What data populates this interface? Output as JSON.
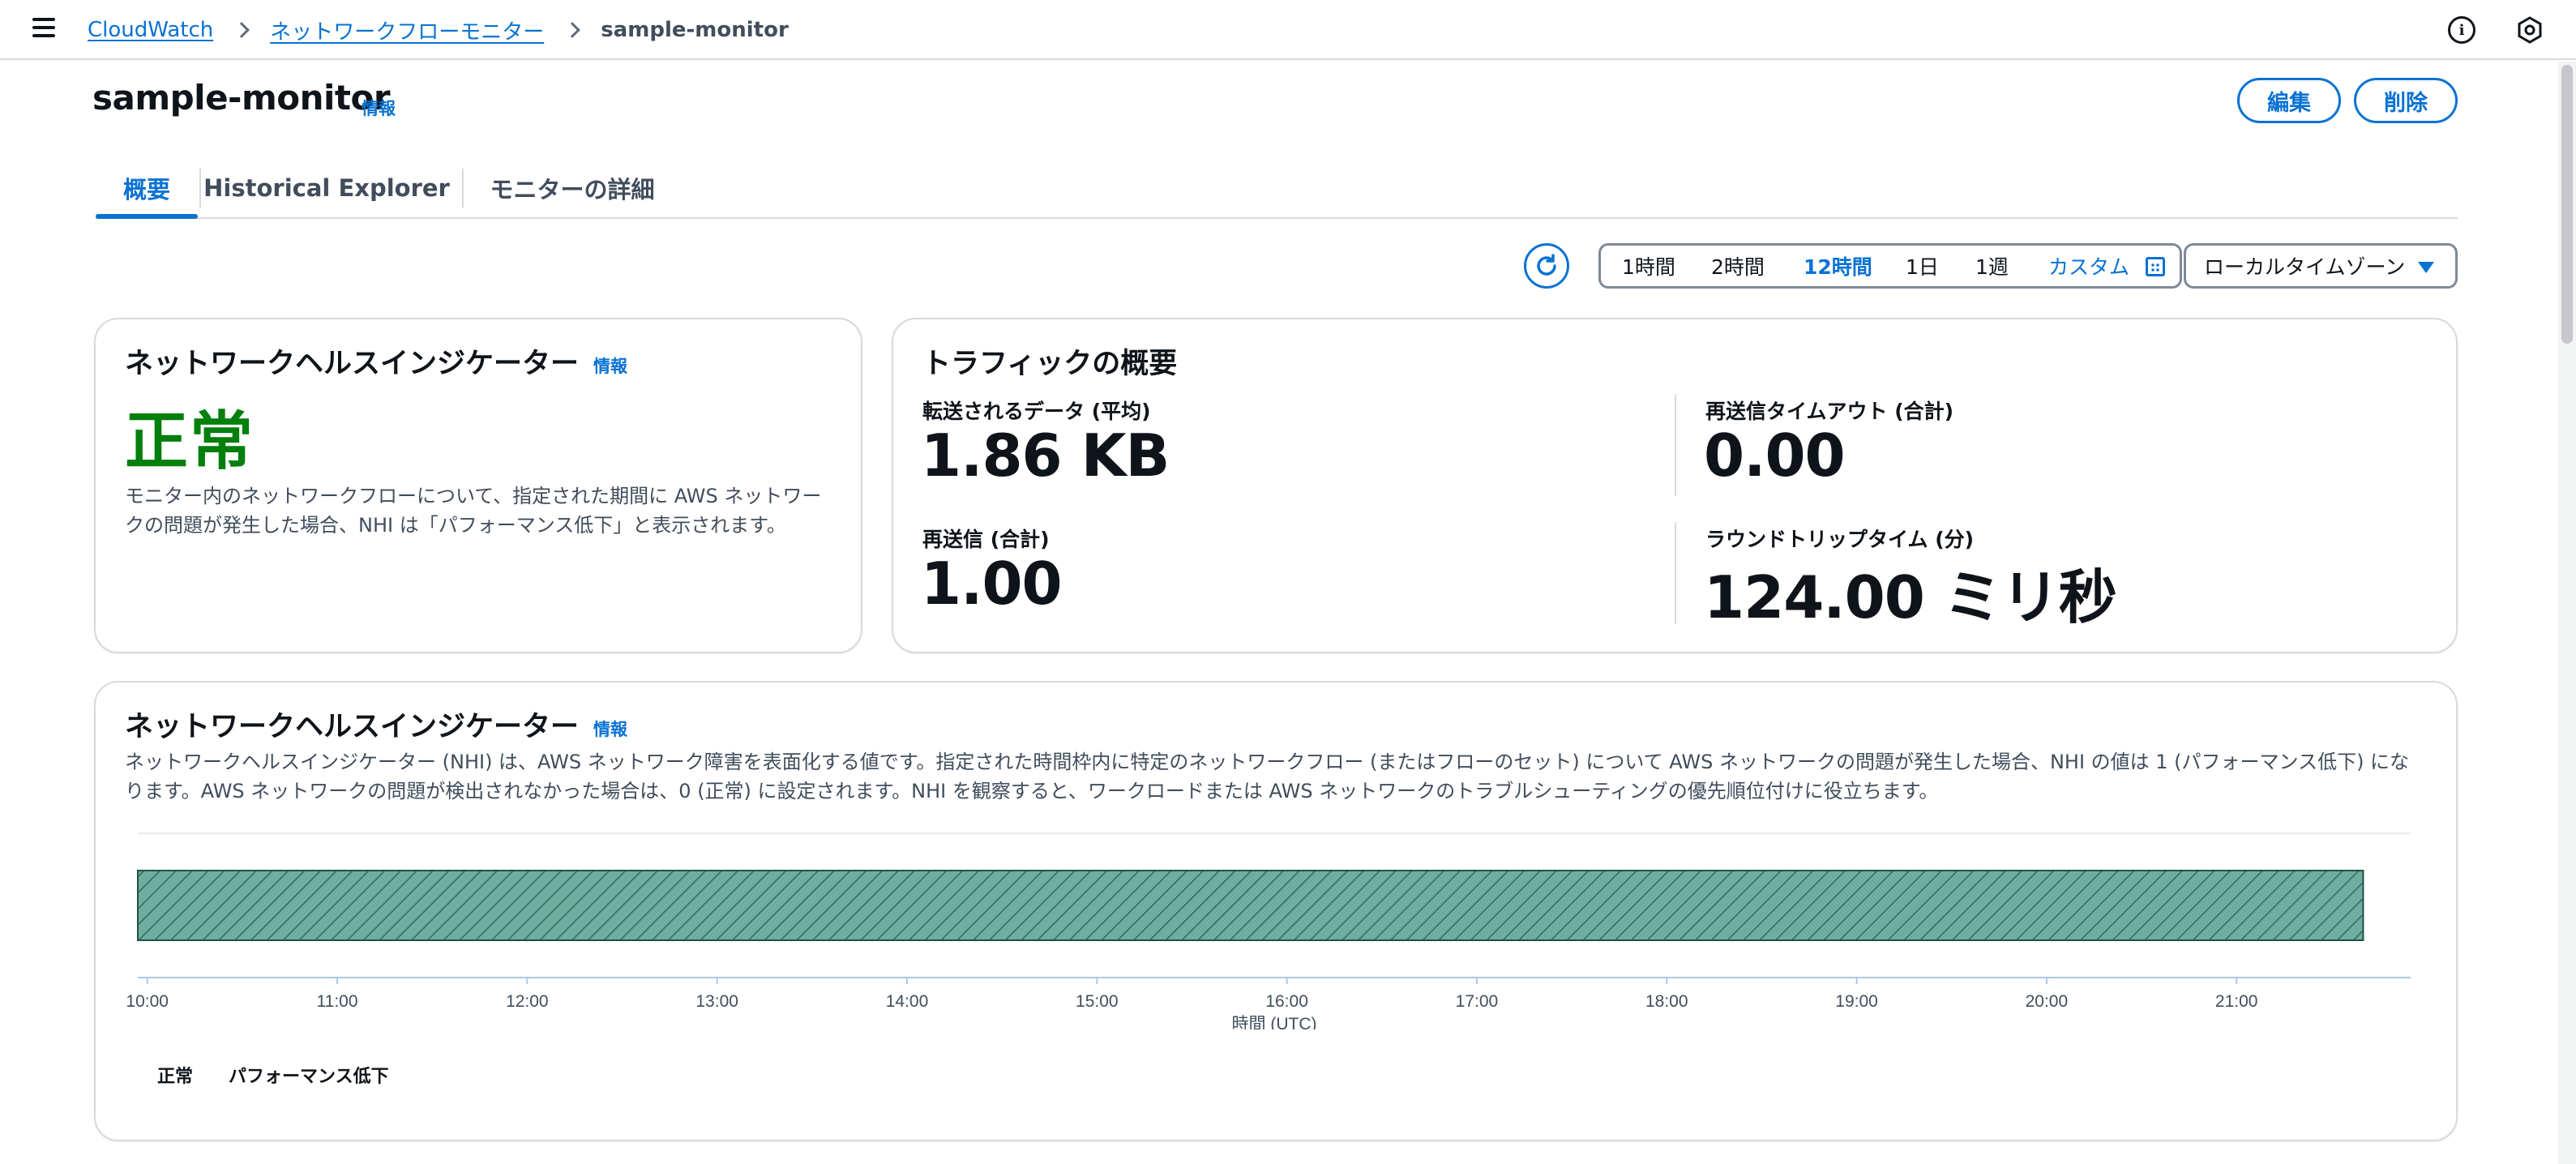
{
  "breadcrumb": {
    "items": [
      "CloudWatch",
      "ネットワークフローモニター"
    ],
    "current": "sample-monitor"
  },
  "header": {
    "title": "sample-monitor",
    "info": "情報",
    "edit_label": "編集",
    "delete_label": "削除"
  },
  "tabs": [
    {
      "label": "概要",
      "active": true
    },
    {
      "label": "Historical Explorer",
      "active": false
    },
    {
      "label": "モニターの詳細",
      "active": false
    }
  ],
  "time_range": {
    "options": [
      "1時間",
      "2時間",
      "12時間",
      "1日",
      "1週"
    ],
    "selected": "12時間",
    "custom_label": "カスタム",
    "timezone": "ローカルタイムゾーン"
  },
  "health_card": {
    "title": "ネットワークヘルスインジケーター",
    "info": "情報",
    "status": "正常",
    "status_color": "#037f0c",
    "description": "モニター内のネットワークフローについて、指定された期間に AWS ネットワークの問題が発生した場合、NHI は「パフォーマンス低下」と表示されます。"
  },
  "traffic_card": {
    "title": "トラフィックの概要",
    "metrics": [
      {
        "label": "転送されるデータ (平均)",
        "value": "1.86 KB"
      },
      {
        "label": "再送信タイムアウト (合計)",
        "value": "0.00"
      },
      {
        "label": "再送信 (合計)",
        "value": "1.00"
      },
      {
        "label": "ラウンドトリップタイム (分)",
        "value": "124.00 ミリ秒"
      }
    ]
  },
  "nhi_card": {
    "title": "ネットワークヘルスインジケーター",
    "info": "情報",
    "description": "ネットワークヘルスインジケーター (NHI) は、AWS ネットワーク障害を表面化する値です。指定された時間枠内に特定のネットワークフロー (またはフローのセット) について AWS ネットワークの問題が発生した場合、NHI の値は 1 (パフォーマンス低下) になります。AWS ネットワークの問題が検出されなかった場合は、0 (正常) に設定されます。NHI を観察すると、ワークロードまたは AWS ネットワークのトラブルシューティングの優先順位付けに役立ちます。"
  },
  "chart_data": {
    "type": "bar",
    "xlabel": "時間 (UTC)",
    "x_ticks": [
      "10:00",
      "11:00",
      "12:00",
      "13:00",
      "14:00",
      "15:00",
      "16:00",
      "17:00",
      "18:00",
      "19:00",
      "20:00",
      "21:00"
    ],
    "xlim": [
      "09:57",
      "21:55"
    ],
    "series": [
      {
        "name": "正常",
        "start": "09:57",
        "end": "21:40",
        "value": 0,
        "color": "#5fa896"
      }
    ],
    "legend": [
      "正常",
      "パフォーマンス低下"
    ],
    "legend_position": "bottom-left",
    "grid": false
  }
}
